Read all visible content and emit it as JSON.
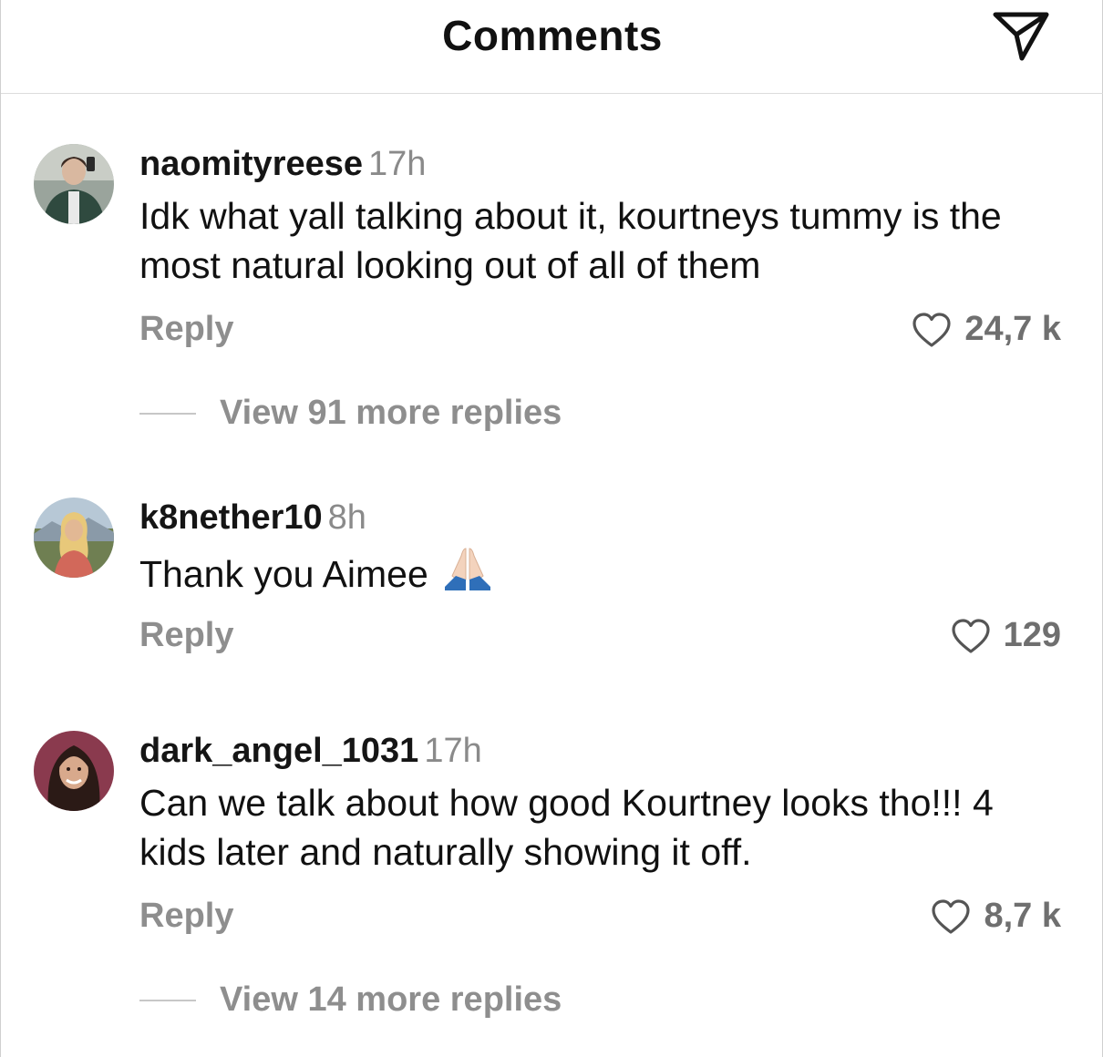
{
  "header": {
    "title": "Comments",
    "share_icon": "paper-plane-icon"
  },
  "comments": [
    {
      "username": "naomityreese",
      "time": "17h",
      "text": "Idk what yall talking about it, kourtneys tummy is the most natural looking out of all of them",
      "reply_label": "Reply",
      "likes": "24,7 k",
      "view_replies": "View 91 more replies"
    },
    {
      "username": "k8nether10",
      "time": "8h",
      "text": "Thank you Aimee",
      "emoji": "folded-hands-emoji",
      "reply_label": "Reply",
      "likes": "129"
    },
    {
      "username": "dark_angel_1031",
      "time": "17h",
      "text": "Can we talk about how good Kourtney looks tho!!! 4 kids later and naturally showing it off.",
      "reply_label": "Reply",
      "likes": "8,7 k",
      "view_replies": "View 14 more replies"
    }
  ],
  "colors": {
    "muted": "#8e8e8e",
    "text": "#111111",
    "divider": "#dcdcdc"
  }
}
